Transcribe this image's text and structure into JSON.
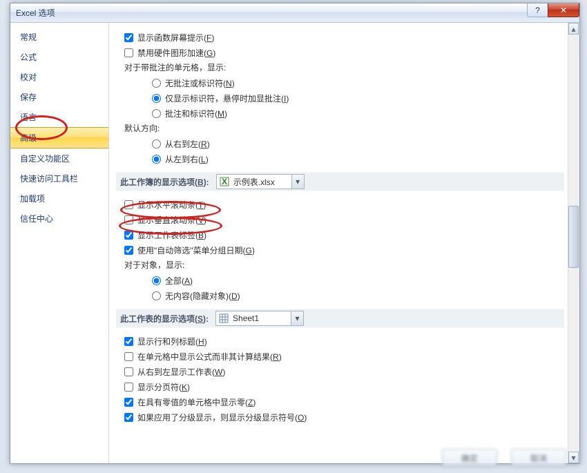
{
  "window": {
    "title": "Excel 选项"
  },
  "sidebar": {
    "items": [
      {
        "label": "常规"
      },
      {
        "label": "公式"
      },
      {
        "label": "校对"
      },
      {
        "label": "保存"
      },
      {
        "label": "语言"
      },
      {
        "label": "高级"
      },
      {
        "label": "自定义功能区"
      },
      {
        "label": "快速访问工具栏"
      },
      {
        "label": "加载项"
      },
      {
        "label": "信任中心"
      }
    ],
    "selected_index": 5
  },
  "content": {
    "top_checks": [
      {
        "label": "显示函数屏幕提示",
        "hotkey": "F",
        "checked": true
      },
      {
        "label": "禁用硬件图形加速",
        "hotkey": "G",
        "checked": false
      }
    ],
    "comments_header": "对于带批注的单元格，显示:",
    "comments_radios": [
      {
        "label": "无批注或标识符",
        "hotkey": "N",
        "checked": false
      },
      {
        "label": "仅显示标识符，悬停时加显批注",
        "hotkey": "I",
        "checked": true
      },
      {
        "label": "批注和标识符",
        "hotkey": "M",
        "checked": false
      }
    ],
    "direction_header": "默认方向:",
    "direction_radios": [
      {
        "label": "从右到左",
        "hotkey": "R",
        "checked": false
      },
      {
        "label": "从左到右",
        "hotkey": "L",
        "checked": true
      }
    ],
    "workbook_section": {
      "label": "此工作簿的显示选项",
      "hotkey": "B",
      "value": "示例表.xlsx"
    },
    "workbook_checks": [
      {
        "label": "显示水平滚动条",
        "hotkey": "T",
        "checked": false
      },
      {
        "label": "显示垂直滚动条",
        "hotkey": "V",
        "checked": false
      },
      {
        "label": "显示工作表标签",
        "hotkey": "B",
        "checked": true
      },
      {
        "label": "使用\"自动筛选\"菜单分组日期",
        "hotkey": "G",
        "checked": true
      }
    ],
    "objects_header": "对于对象，显示:",
    "objects_radios": [
      {
        "label": "全部",
        "hotkey": "A",
        "checked": true
      },
      {
        "label": "无内容(隐藏对象)",
        "hotkey": "D",
        "checked": false
      }
    ],
    "worksheet_section": {
      "label": "此工作表的显示选项",
      "hotkey": "S",
      "value": "Sheet1"
    },
    "worksheet_checks": [
      {
        "label": "显示行和列标题",
        "hotkey": "H",
        "checked": true
      },
      {
        "label": "在单元格中显示公式而非其计算结果",
        "hotkey": "R",
        "checked": false
      },
      {
        "label": "从右到左显示工作表",
        "hotkey": "W",
        "checked": false
      },
      {
        "label": "显示分页符",
        "hotkey": "K",
        "checked": false
      },
      {
        "label": "在具有零值的单元格中显示零",
        "hotkey": "Z",
        "checked": true
      },
      {
        "label": "如果应用了分级显示，则显示分级显示符号",
        "hotkey": "O",
        "checked": true
      }
    ]
  },
  "buttons": {
    "help": "?",
    "close": "✕"
  },
  "footer": {
    "ok": "确定",
    "cancel": "取消"
  }
}
